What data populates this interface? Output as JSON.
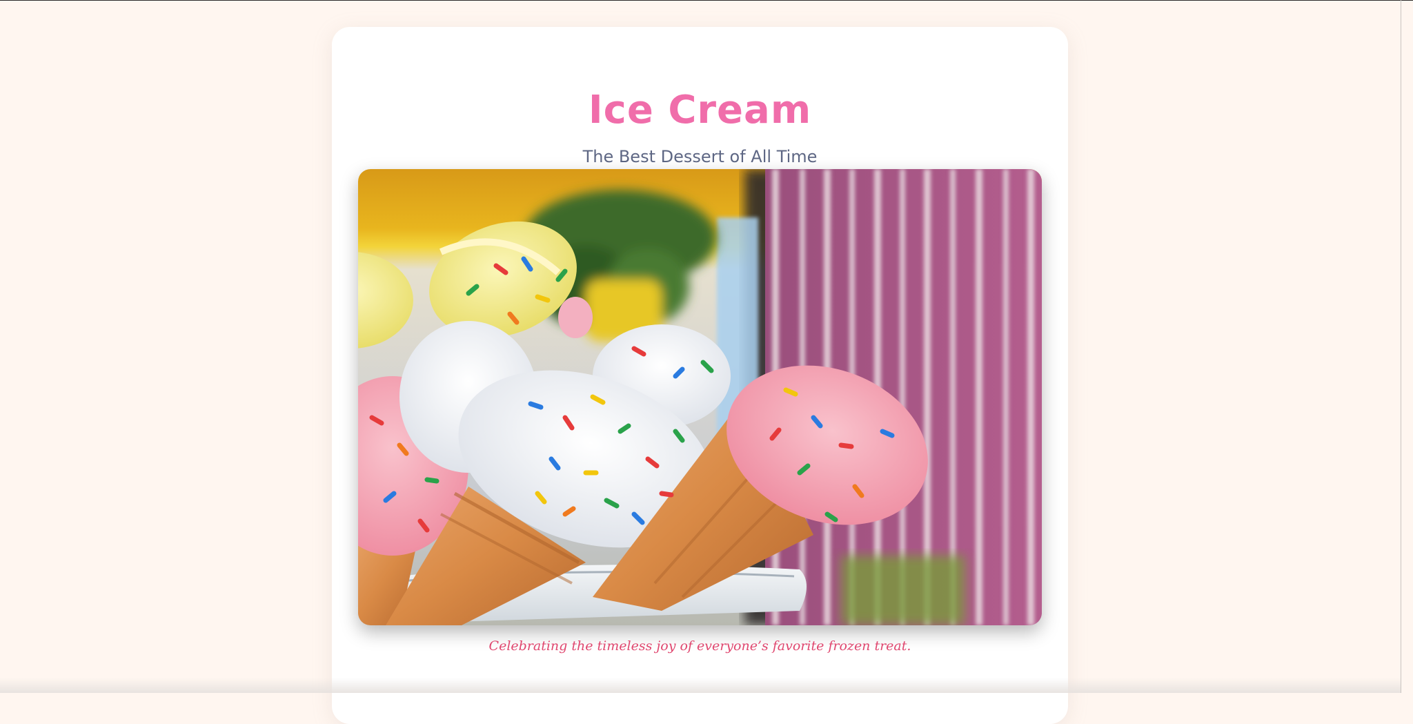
{
  "header": {
    "title": "Ice Cream",
    "subtitle": "The Best Dessert of All Time"
  },
  "hero": {
    "image_subject": "ice-cream-cones-with-sprinkles",
    "caption": "Celebrating the timeless joy of everyone’s favorite frozen treat."
  },
  "colors": {
    "page_background": "#fff6f0",
    "card_background": "#ffffff",
    "title": "#f06daa",
    "subtitle": "#5e6784",
    "caption": "#e0476f"
  }
}
